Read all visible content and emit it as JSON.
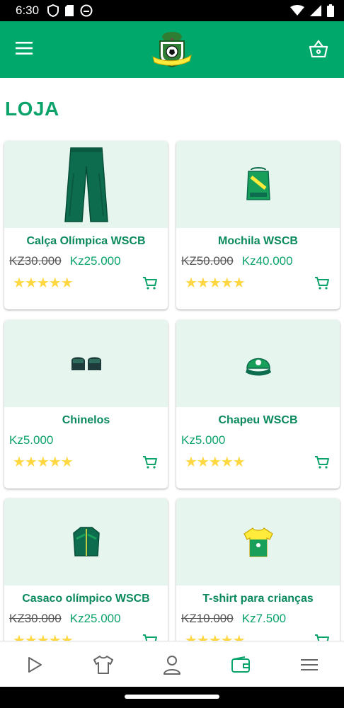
{
  "status_bar": {
    "time": "6:30"
  },
  "app_bar": {
    "logo_alt": "WSCB club logo"
  },
  "page": {
    "title": "LOJA"
  },
  "products": [
    {
      "name": "Calça Olímpica WSCB",
      "old_price": "KZ30.000",
      "price": "Kz25.000",
      "stars": "★★★★★",
      "rating": 5,
      "image": "pants"
    },
    {
      "name": "Mochila WSCB",
      "old_price": "KZ50.000",
      "price": "Kz40.000",
      "stars": "★★★★★",
      "rating": 5,
      "image": "bag"
    },
    {
      "name": "Chinelos",
      "old_price": "",
      "price": "Kz5.000",
      "stars": "★★★★★",
      "rating": 5,
      "image": "slippers"
    },
    {
      "name": "Chapeu WSCB",
      "old_price": "",
      "price": "Kz5.000",
      "stars": "★★★★★",
      "rating": 5,
      "image": "cap"
    },
    {
      "name": "Casaco olímpico WSCB",
      "old_price": "KZ30.000",
      "price": "Kz25.000",
      "stars": "★★★★★",
      "rating": 5,
      "image": "jacket"
    },
    {
      "name": "T-shirt para crianças",
      "old_price": "KZ10.000",
      "price": "Kz7.500",
      "stars": "★★★★★",
      "rating": 5,
      "image": "tshirt"
    }
  ],
  "bottom_nav": [
    {
      "icon": "play-icon",
      "active": false
    },
    {
      "icon": "shirt-icon",
      "active": false
    },
    {
      "icon": "person-icon",
      "active": false
    },
    {
      "icon": "wallet-icon",
      "active": true
    },
    {
      "icon": "menu-icon",
      "active": false
    }
  ],
  "colors": {
    "primary": "#00a86b",
    "accent_text": "#0aa36a",
    "star": "#ffd740",
    "image_bg": "#e6f6ee"
  }
}
